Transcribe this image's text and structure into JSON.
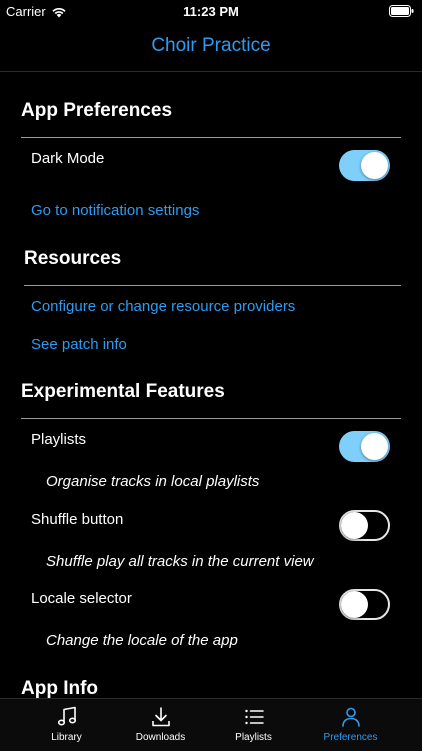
{
  "status_bar": {
    "carrier": "Carrier",
    "time": "11:23 PM"
  },
  "nav": {
    "title": "Choir Practice"
  },
  "sections": {
    "app_preferences": {
      "header": "App Preferences",
      "dark_mode_label": "Dark Mode",
      "dark_mode_on": true,
      "notification_link": "Go to notification settings"
    },
    "resources": {
      "header": "Resources",
      "configure_link": "Configure or change resource providers",
      "patch_link": "See patch info"
    },
    "experimental": {
      "header": "Experimental Features",
      "playlists_label": "Playlists",
      "playlists_on": true,
      "playlists_desc": "Organise tracks in local playlists",
      "shuffle_label": "Shuffle button",
      "shuffle_on": false,
      "shuffle_desc": "Shuffle play all tracks in the current view",
      "locale_label": "Locale selector",
      "locale_on": false,
      "locale_desc": "Change the locale of the app"
    },
    "app_info": {
      "header": "App Info"
    }
  },
  "tabs": [
    {
      "label": "Library",
      "icon": "music-note-icon"
    },
    {
      "label": "Downloads",
      "icon": "download-icon"
    },
    {
      "label": "Playlists",
      "icon": "list-icon"
    },
    {
      "label": "Preferences",
      "icon": "person-icon",
      "active": true
    }
  ],
  "colors": {
    "accent": "#2f9bf0",
    "toggle_on": "#7ed0fb",
    "background": "#000000"
  }
}
